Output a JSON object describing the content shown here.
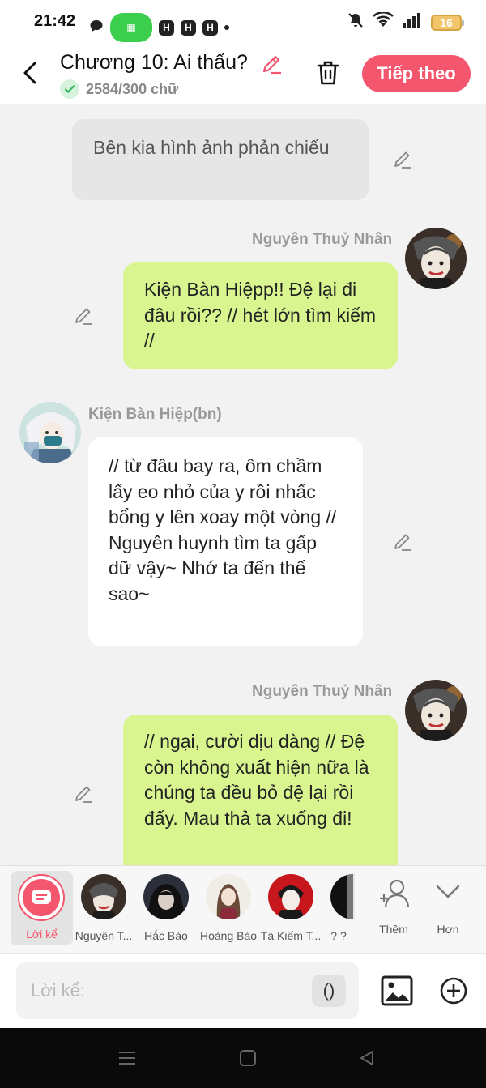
{
  "status_bar": {
    "time": "21:42",
    "battery": "16"
  },
  "header": {
    "title": "Chương 10: Ai thấu?",
    "word_count": "2584/300 chữ",
    "next_label": "Tiếp theo"
  },
  "messages": [
    {
      "type": "narration",
      "text": "Bên kia hình ảnh phản chiếu"
    },
    {
      "type": "right",
      "name": "Nguyên Thuỷ Nhân",
      "text": "Kiện Bàn Hiệpp!! Đệ lại đi đâu rồi?? // hét lớn tìm kiếm //"
    },
    {
      "type": "left",
      "name": "Kiện Bàn Hiệp(bn)",
      "text": "// từ đâu bay ra, ôm chầm lấy eo nhỏ của y rồi nhấc bổng y lên xoay một vòng // Nguyên huynh tìm ta gấp dữ vậy~ Nhớ ta đến thế sao~"
    },
    {
      "type": "right",
      "name": "Nguyên Thuỷ Nhân",
      "text": "// ngại, cười dịu dàng // Đệ còn không xuất hiện nữa là chúng ta đều bỏ đệ lại rồi đấy. Mau thả ta xuống đi!"
    }
  ],
  "characters": {
    "narrator_label": "Lời kể",
    "items": [
      "Nguyên T...",
      "Hắc Bào",
      "Hoàng Bào",
      "Tà Kiếm T...",
      "? ?"
    ],
    "add_label": "Thêm",
    "more_label": "Hơn"
  },
  "input": {
    "placeholder": "Lời kể:",
    "paren_label": "()"
  },
  "colors": {
    "accent": "#f4566e",
    "bubble_green": "#d8f58f",
    "bubble_white": "#ffffff",
    "narration": "#e6e6e6"
  }
}
